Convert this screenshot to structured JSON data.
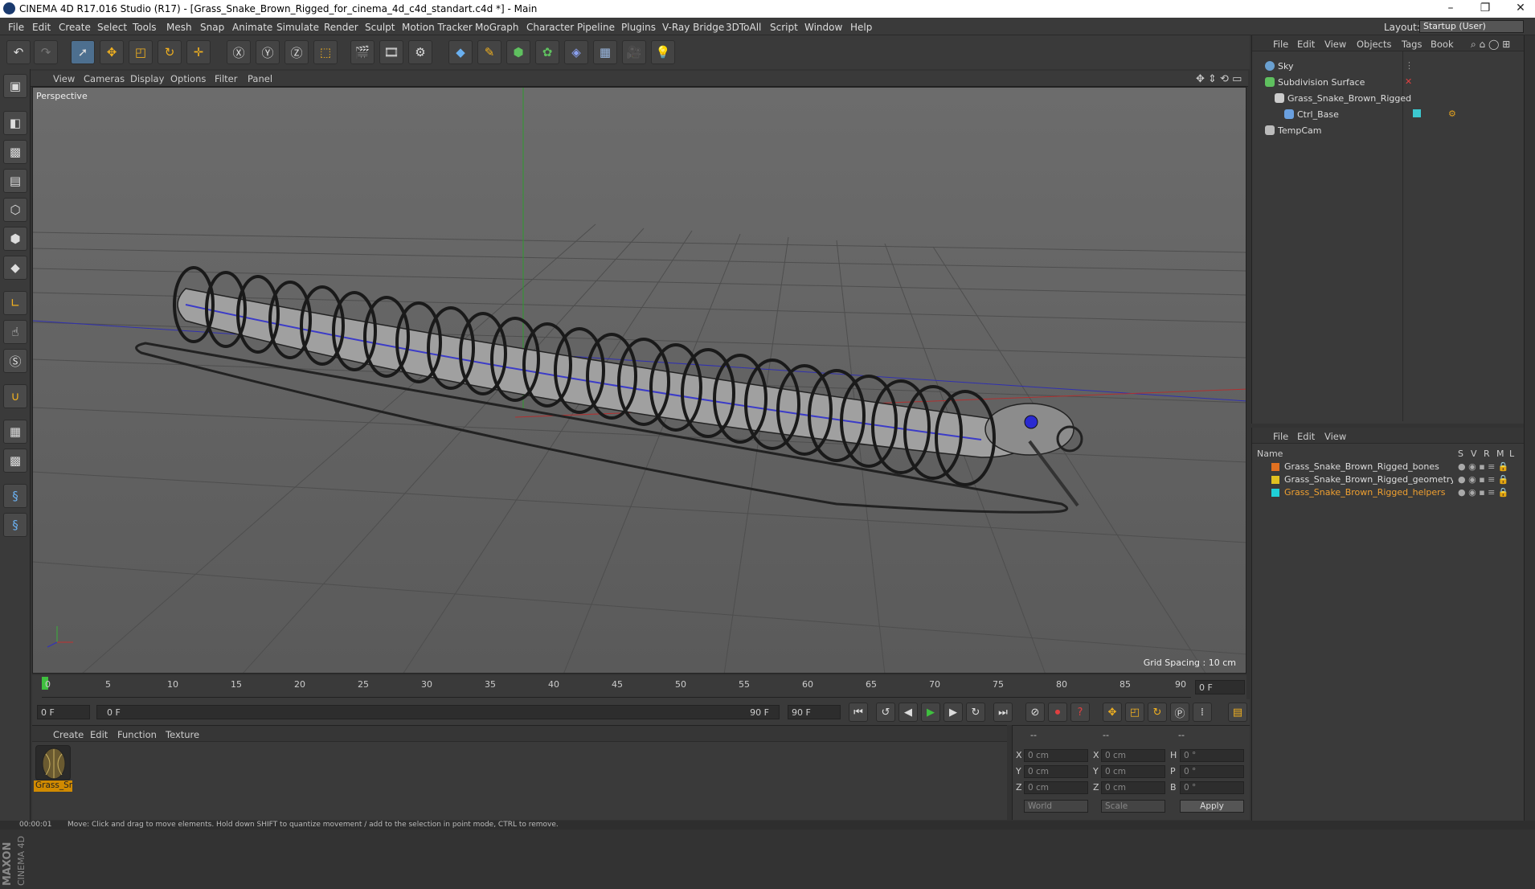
{
  "window": {
    "title": "CINEMA 4D R17.016 Studio (R17) - [Grass_Snake_Brown_Rigged_for_cinema_4d_c4d_standart.c4d *] - Main",
    "minimize": "–",
    "restore": "❐",
    "close": "✕"
  },
  "menubar": {
    "items": [
      "File",
      "Edit",
      "Create",
      "Select",
      "Tools",
      "Mesh",
      "Snap",
      "Animate",
      "Simulate",
      "Render",
      "Sculpt",
      "Motion Tracker",
      "MoGraph",
      "Character",
      "Pipeline",
      "Plugins",
      "V-Ray Bridge",
      "3DToAll",
      "Script",
      "Window",
      "Help"
    ],
    "layout_label": "Layout:",
    "layout_value": "Startup (User)"
  },
  "viewport": {
    "menu": [
      "View",
      "Cameras",
      "Display",
      "Options",
      "Filter",
      "Panel"
    ],
    "label": "Perspective",
    "grid_spacing": "Grid Spacing : 10 cm"
  },
  "timeline": {
    "ticks": [
      "0",
      "5",
      "10",
      "15",
      "20",
      "25",
      "30",
      "35",
      "40",
      "45",
      "50",
      "55",
      "60",
      "65",
      "70",
      "75",
      "80",
      "85",
      "90"
    ],
    "current_frame": "0 F"
  },
  "transport": {
    "start_field": "0 F",
    "slider_start": "0 F",
    "slider_end": "90 F",
    "end_field": "90 F"
  },
  "materials": {
    "menu": [
      "Create",
      "Edit",
      "Function",
      "Texture"
    ],
    "items": [
      {
        "name": "Grass_Sn"
      }
    ]
  },
  "coords": {
    "headers": [
      "--",
      "--",
      "--"
    ],
    "rows": [
      {
        "a": "X",
        "a_val": "0 cm",
        "b": "X",
        "b_val": "0 cm",
        "c": "H",
        "c_val": "0 °"
      },
      {
        "a": "Y",
        "a_val": "0 cm",
        "b": "Y",
        "b_val": "0 cm",
        "c": "P",
        "c_val": "0 °"
      },
      {
        "a": "Z",
        "a_val": "0 cm",
        "b": "Z",
        "b_val": "0 cm",
        "c": "B",
        "c_val": "0 °"
      }
    ],
    "world": "World",
    "scale": "Scale",
    "apply": "Apply"
  },
  "object_manager": {
    "menu": [
      "File",
      "Edit",
      "View",
      "Objects",
      "Tags",
      "Book"
    ],
    "objects": [
      {
        "name": "Sky",
        "indent": 0,
        "color": "#6aa0d0"
      },
      {
        "name": "Subdivision Surface",
        "indent": 0,
        "color": "#5fc05f"
      },
      {
        "name": "Grass_Snake_Brown_Rigged",
        "indent": 1,
        "color": "#cccccc"
      },
      {
        "name": "Ctrl_Base",
        "indent": 2,
        "color": "#6aa0e0"
      },
      {
        "name": "TempCam",
        "indent": 0,
        "color": "#bbbbbb"
      }
    ]
  },
  "layer_manager": {
    "menu": [
      "File",
      "Edit",
      "View"
    ],
    "columns": [
      "Name",
      "S",
      "V",
      "R",
      "M",
      "L"
    ],
    "layers": [
      {
        "name": "Grass_Snake_Brown_Rigged_bones",
        "color": "#e07020",
        "text_color": "#dddddd"
      },
      {
        "name": "Grass_Snake_Brown_Rigged_geometry",
        "color": "#e0c020",
        "text_color": "#dddddd"
      },
      {
        "name": "Grass_Snake_Brown_Rigged_helpers",
        "color": "#20d0d8",
        "text_color": "#f0a030"
      }
    ]
  },
  "status": {
    "time": "00:00:01",
    "message": "Move: Click and drag to move elements. Hold down SHIFT to quantize movement / add to the selection in point mode, CTRL to remove."
  },
  "branding": {
    "maxon": "MAXON",
    "cinema": "CINEMA 4D"
  }
}
